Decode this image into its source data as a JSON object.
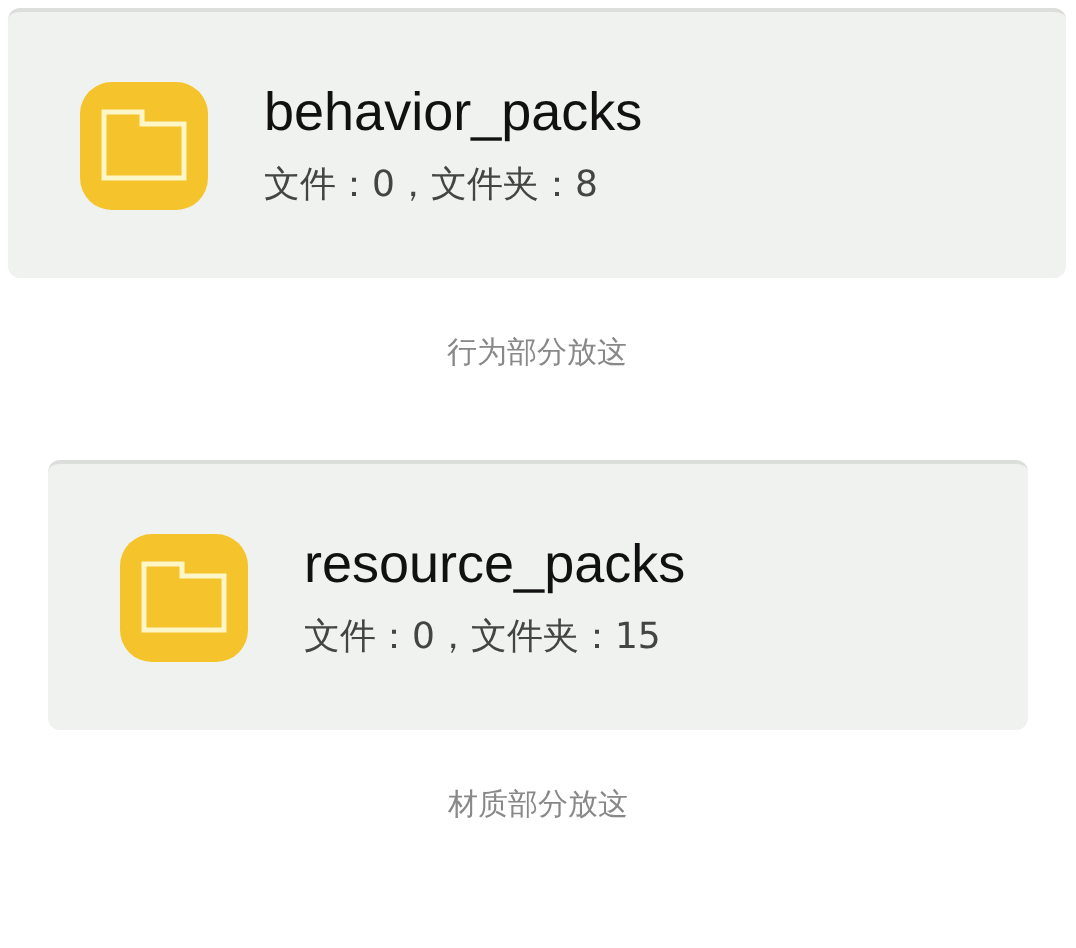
{
  "folders": [
    {
      "name": "behavior_packs",
      "summary": "文件：0，文件夹：8",
      "caption": "行为部分放这"
    },
    {
      "name": "resource_packs",
      "summary": "文件：0，文件夹：15",
      "caption": "材质部分放这"
    }
  ]
}
